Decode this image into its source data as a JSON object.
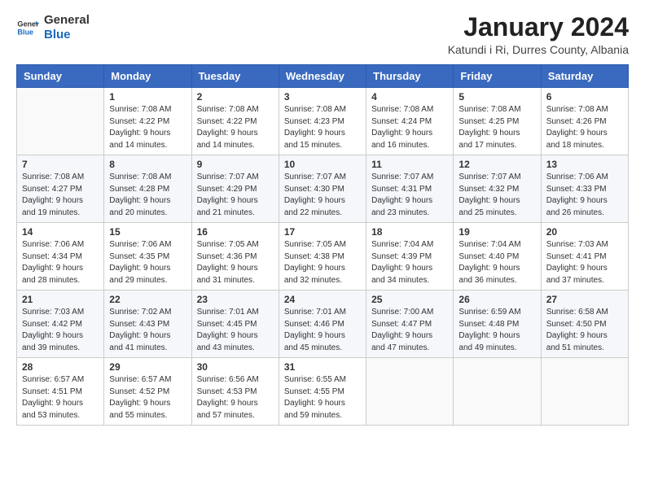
{
  "header": {
    "logo_line1": "General",
    "logo_line2": "Blue",
    "title": "January 2024",
    "subtitle": "Katundi i Ri, Durres County, Albania"
  },
  "calendar": {
    "weekdays": [
      "Sunday",
      "Monday",
      "Tuesday",
      "Wednesday",
      "Thursday",
      "Friday",
      "Saturday"
    ],
    "weeks": [
      [
        {
          "day": "",
          "info": ""
        },
        {
          "day": "1",
          "info": "Sunrise: 7:08 AM\nSunset: 4:22 PM\nDaylight: 9 hours\nand 14 minutes."
        },
        {
          "day": "2",
          "info": "Sunrise: 7:08 AM\nSunset: 4:22 PM\nDaylight: 9 hours\nand 14 minutes."
        },
        {
          "day": "3",
          "info": "Sunrise: 7:08 AM\nSunset: 4:23 PM\nDaylight: 9 hours\nand 15 minutes."
        },
        {
          "day": "4",
          "info": "Sunrise: 7:08 AM\nSunset: 4:24 PM\nDaylight: 9 hours\nand 16 minutes."
        },
        {
          "day": "5",
          "info": "Sunrise: 7:08 AM\nSunset: 4:25 PM\nDaylight: 9 hours\nand 17 minutes."
        },
        {
          "day": "6",
          "info": "Sunrise: 7:08 AM\nSunset: 4:26 PM\nDaylight: 9 hours\nand 18 minutes."
        }
      ],
      [
        {
          "day": "7",
          "info": "Sunrise: 7:08 AM\nSunset: 4:27 PM\nDaylight: 9 hours\nand 19 minutes."
        },
        {
          "day": "8",
          "info": "Sunrise: 7:08 AM\nSunset: 4:28 PM\nDaylight: 9 hours\nand 20 minutes."
        },
        {
          "day": "9",
          "info": "Sunrise: 7:07 AM\nSunset: 4:29 PM\nDaylight: 9 hours\nand 21 minutes."
        },
        {
          "day": "10",
          "info": "Sunrise: 7:07 AM\nSunset: 4:30 PM\nDaylight: 9 hours\nand 22 minutes."
        },
        {
          "day": "11",
          "info": "Sunrise: 7:07 AM\nSunset: 4:31 PM\nDaylight: 9 hours\nand 23 minutes."
        },
        {
          "day": "12",
          "info": "Sunrise: 7:07 AM\nSunset: 4:32 PM\nDaylight: 9 hours\nand 25 minutes."
        },
        {
          "day": "13",
          "info": "Sunrise: 7:06 AM\nSunset: 4:33 PM\nDaylight: 9 hours\nand 26 minutes."
        }
      ],
      [
        {
          "day": "14",
          "info": "Sunrise: 7:06 AM\nSunset: 4:34 PM\nDaylight: 9 hours\nand 28 minutes."
        },
        {
          "day": "15",
          "info": "Sunrise: 7:06 AM\nSunset: 4:35 PM\nDaylight: 9 hours\nand 29 minutes."
        },
        {
          "day": "16",
          "info": "Sunrise: 7:05 AM\nSunset: 4:36 PM\nDaylight: 9 hours\nand 31 minutes."
        },
        {
          "day": "17",
          "info": "Sunrise: 7:05 AM\nSunset: 4:38 PM\nDaylight: 9 hours\nand 32 minutes."
        },
        {
          "day": "18",
          "info": "Sunrise: 7:04 AM\nSunset: 4:39 PM\nDaylight: 9 hours\nand 34 minutes."
        },
        {
          "day": "19",
          "info": "Sunrise: 7:04 AM\nSunset: 4:40 PM\nDaylight: 9 hours\nand 36 minutes."
        },
        {
          "day": "20",
          "info": "Sunrise: 7:03 AM\nSunset: 4:41 PM\nDaylight: 9 hours\nand 37 minutes."
        }
      ],
      [
        {
          "day": "21",
          "info": "Sunrise: 7:03 AM\nSunset: 4:42 PM\nDaylight: 9 hours\nand 39 minutes."
        },
        {
          "day": "22",
          "info": "Sunrise: 7:02 AM\nSunset: 4:43 PM\nDaylight: 9 hours\nand 41 minutes."
        },
        {
          "day": "23",
          "info": "Sunrise: 7:01 AM\nSunset: 4:45 PM\nDaylight: 9 hours\nand 43 minutes."
        },
        {
          "day": "24",
          "info": "Sunrise: 7:01 AM\nSunset: 4:46 PM\nDaylight: 9 hours\nand 45 minutes."
        },
        {
          "day": "25",
          "info": "Sunrise: 7:00 AM\nSunset: 4:47 PM\nDaylight: 9 hours\nand 47 minutes."
        },
        {
          "day": "26",
          "info": "Sunrise: 6:59 AM\nSunset: 4:48 PM\nDaylight: 9 hours\nand 49 minutes."
        },
        {
          "day": "27",
          "info": "Sunrise: 6:58 AM\nSunset: 4:50 PM\nDaylight: 9 hours\nand 51 minutes."
        }
      ],
      [
        {
          "day": "28",
          "info": "Sunrise: 6:57 AM\nSunset: 4:51 PM\nDaylight: 9 hours\nand 53 minutes."
        },
        {
          "day": "29",
          "info": "Sunrise: 6:57 AM\nSunset: 4:52 PM\nDaylight: 9 hours\nand 55 minutes."
        },
        {
          "day": "30",
          "info": "Sunrise: 6:56 AM\nSunset: 4:53 PM\nDaylight: 9 hours\nand 57 minutes."
        },
        {
          "day": "31",
          "info": "Sunrise: 6:55 AM\nSunset: 4:55 PM\nDaylight: 9 hours\nand 59 minutes."
        },
        {
          "day": "",
          "info": ""
        },
        {
          "day": "",
          "info": ""
        },
        {
          "day": "",
          "info": ""
        }
      ]
    ]
  }
}
